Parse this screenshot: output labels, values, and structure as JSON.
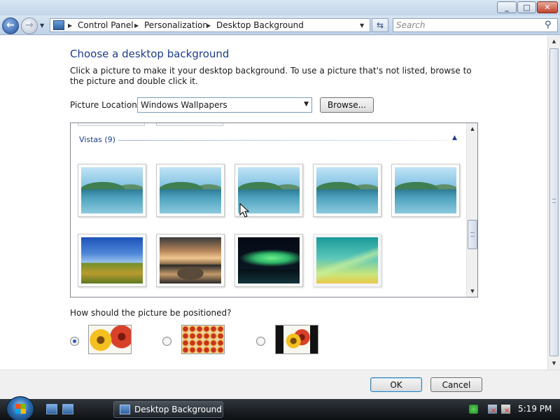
{
  "window": {
    "minimize_glyph": "_",
    "maximize_glyph": "□",
    "close_glyph": "✕"
  },
  "navigation": {
    "back_glyph": "←",
    "forward_glyph": "→",
    "breadcrumb": [
      "Control Panel",
      "Personalization",
      "Desktop Background"
    ],
    "search_placeholder": "Search"
  },
  "page": {
    "title": "Choose a desktop background",
    "instructions": "Click a picture to make it your desktop background. To use a picture that's not listed, browse to the picture and double click it.",
    "picture_location_label": "Picture Location",
    "picture_location_value": "Windows Wallpapers",
    "browse_label": "Browse..."
  },
  "gallery": {
    "group_label": "Vistas (9)",
    "pictures": [
      {
        "style": "img-vista-lake",
        "name": "vista-lake-1"
      },
      {
        "style": "img-vista-lake",
        "name": "vista-lake-2"
      },
      {
        "style": "img-vista-lake",
        "name": "vista-lake-3"
      },
      {
        "style": "img-vista-lake",
        "name": "vista-lake-4"
      },
      {
        "style": "img-vista-lake",
        "name": "vista-lake-5"
      },
      {
        "style": "img-hills",
        "name": "vista-hills"
      },
      {
        "style": "img-rocks",
        "name": "vista-rocks"
      },
      {
        "style": "img-aurora",
        "name": "vista-aurora"
      },
      {
        "style": "img-aero",
        "name": "vista-aero",
        "selected": true
      }
    ]
  },
  "positioning": {
    "question": "How should the picture be positioned?",
    "options": [
      {
        "name": "fit-to-screen",
        "selected": true
      },
      {
        "name": "tile",
        "selected": false
      },
      {
        "name": "center",
        "selected": false
      }
    ]
  },
  "buttons": {
    "ok": "OK",
    "cancel": "Cancel"
  },
  "taskbar": {
    "task_label": "Desktop Background",
    "clock": "5:19 PM"
  }
}
